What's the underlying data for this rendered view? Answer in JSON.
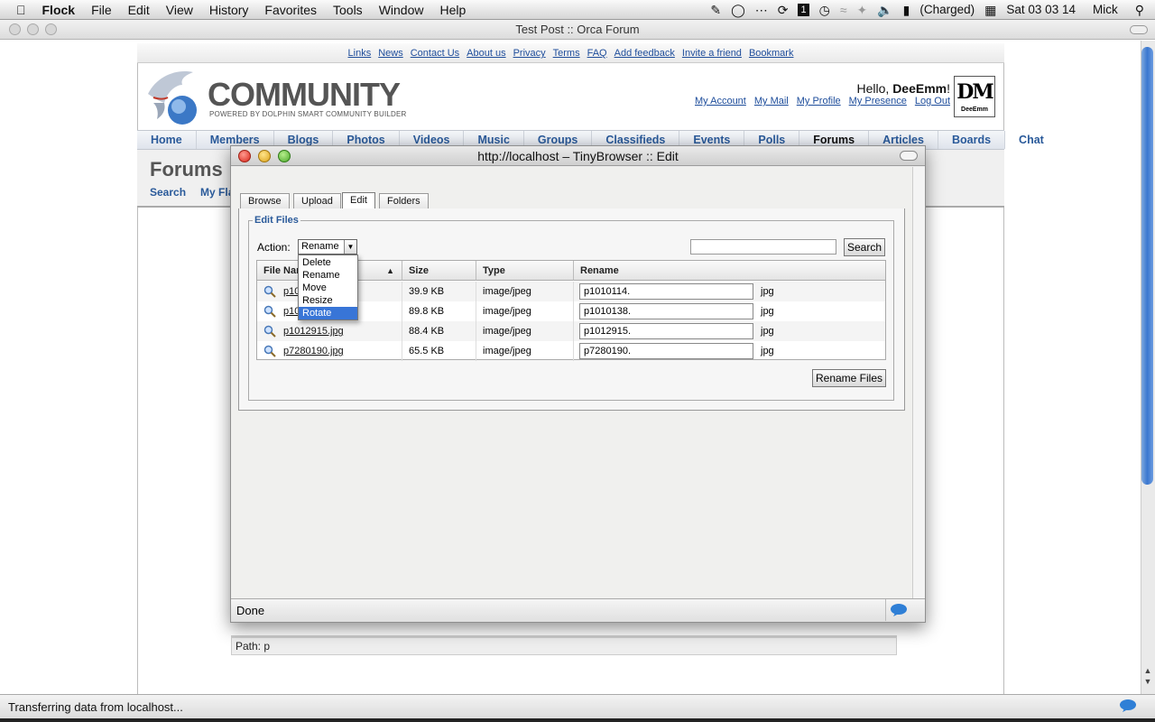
{
  "menubar": {
    "app": "Flock",
    "items": [
      "File",
      "Edit",
      "View",
      "History",
      "Favorites",
      "Tools",
      "Window",
      "Help"
    ],
    "battery": "(Charged)",
    "clock": "Sat 03 03 14",
    "user": "Mick"
  },
  "window": {
    "title": "Test Post :: Orca Forum"
  },
  "site": {
    "toplinks": [
      "Links",
      "News",
      "Contact Us",
      "About us",
      "Privacy",
      "Terms",
      "FAQ",
      "Add feedback",
      "Invite a friend",
      "Bookmark"
    ],
    "logo_title": "COMMUNITY",
    "logo_sub": "POWERED BY DOLPHIN SMART COMMUNITY BUILDER",
    "hello_prefix": "Hello, ",
    "hello_name": "DeeEmm",
    "hello_suffix": "!",
    "account_links": [
      "My Account",
      "My Mail",
      "My Profile",
      "My Presence",
      "Log Out"
    ],
    "avatar_text": "DM",
    "avatar_sub": "DeeEmm",
    "nav": [
      "Home",
      "Members",
      "Blogs",
      "Photos",
      "Videos",
      "Music",
      "Groups",
      "Classifieds",
      "Events",
      "Polls",
      "Forums",
      "Articles",
      "Boards",
      "Chat"
    ],
    "nav_current": "Forums",
    "section_title": "Forums",
    "section_links": [
      "Search",
      "My Fla"
    ],
    "path_label": "Path: p"
  },
  "status": {
    "text": "Transferring data from localhost..."
  },
  "popup": {
    "title": "http://localhost – TinyBrowser :: Edit",
    "tabs": [
      "Browse",
      "Upload",
      "Edit",
      "Folders"
    ],
    "active_tab": "Edit",
    "legend": "Edit Files",
    "action_label": "Action:",
    "action_value": "Rename",
    "action_options": [
      "Delete",
      "Rename",
      "Move",
      "Resize",
      "Rotate"
    ],
    "action_highlighted": "Rotate",
    "search_placeholder": "",
    "search_button": "Search",
    "columns": [
      "File Name",
      "Size",
      "Type",
      "Rename"
    ],
    "sort_indicator": "▲",
    "files": [
      {
        "name": "p1010114.jpg",
        "size": "39.9 KB",
        "type": "image/jpeg",
        "rename": "p1010114.",
        "ext": "jpg"
      },
      {
        "name": "p1010138.jpg",
        "size": "89.8 KB",
        "type": "image/jpeg",
        "rename": "p1010138.",
        "ext": "jpg"
      },
      {
        "name": "p1012915.jpg",
        "size": "88.4 KB",
        "type": "image/jpeg",
        "rename": "p1012915.",
        "ext": "jpg"
      },
      {
        "name": "p7280190.jpg",
        "size": "65.5 KB",
        "type": "image/jpeg",
        "rename": "p7280190.",
        "ext": "jpg"
      }
    ],
    "rename_button": "Rename Files",
    "status": "Done"
  },
  "colors": {
    "link": "#1e4d9b",
    "nav": "#2a5a9a",
    "highlight": "#3875d7"
  }
}
